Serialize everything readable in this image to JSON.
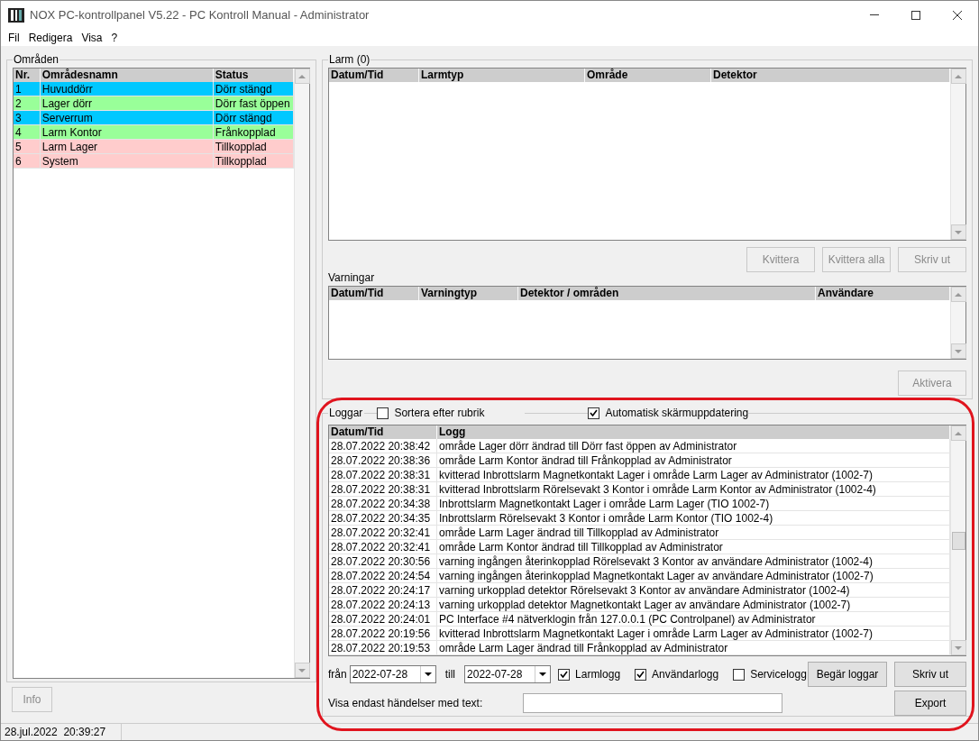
{
  "window": {
    "title": "NOX PC-kontrollpanel V5.22 - PC Kontroll Manual - Administrator"
  },
  "menu": [
    "Fil",
    "Redigera",
    "Visa",
    "?"
  ],
  "areas": {
    "title": "Områden",
    "columns": [
      "Nr.",
      "Områdesnamn",
      "Status"
    ],
    "rows": [
      {
        "nr": "1",
        "name": "Huvuddörr",
        "status": "Dörr stängd",
        "color": "#00c8ff"
      },
      {
        "nr": "2",
        "name": "Lager dörr",
        "status": "Dörr fast öppen",
        "color": "#99ff99"
      },
      {
        "nr": "3",
        "name": "Serverrum",
        "status": "Dörr stängd",
        "color": "#00c8ff"
      },
      {
        "nr": "4",
        "name": "Larm Kontor",
        "status": "Frånkopplad",
        "color": "#99ff99"
      },
      {
        "nr": "5",
        "name": "Larm Lager",
        "status": "Tillkopplad",
        "color": "#ffcccc"
      },
      {
        "nr": "6",
        "name": "System",
        "status": "Tillkopplad",
        "color": "#ffcccc"
      }
    ],
    "info_button": {
      "label": "Info",
      "disabled": true
    }
  },
  "alarms": {
    "title": "Larm (0)",
    "columns": [
      "Datum/Tid",
      "Larmtyp",
      "Område",
      "Detektor"
    ],
    "buttons": [
      {
        "label": "Kvittera",
        "disabled": true
      },
      {
        "label": "Kvittera alla",
        "disabled": true
      },
      {
        "label": "Skriv ut",
        "disabled": true
      }
    ]
  },
  "warnings": {
    "title": "Varningar",
    "columns": [
      "Datum/Tid",
      "Varningtyp",
      "Detektor / områden",
      "Användare"
    ],
    "button": {
      "label": "Aktivera",
      "disabled": true
    }
  },
  "logs": {
    "title": "Loggar",
    "options": [
      {
        "label": "Sortera efter rubrik",
        "checked": false
      },
      {
        "label": "Automatisk skärmuppdatering",
        "checked": true
      }
    ],
    "columns": [
      "Datum/Tid",
      "Logg"
    ],
    "rows": [
      [
        "28.07.2022 20:38:42",
        "område Lager dörr ändrad till Dörr fast öppen av Administrator"
      ],
      [
        "28.07.2022 20:38:36",
        "område Larm Kontor ändrad till Frånkopplad av Administrator"
      ],
      [
        "28.07.2022 20:38:31",
        "kvitterad Inbrottslarm Magnetkontakt Lager i område Larm Lager av Administrator (1002-7)"
      ],
      [
        "28.07.2022 20:38:31",
        "kvitterad Inbrottslarm Rörelsevakt 3 Kontor i område Larm Kontor av Administrator (1002-4)"
      ],
      [
        "28.07.2022 20:34:38",
        "Inbrottslarm Magnetkontakt Lager i område Larm Lager (TIO 1002-7)"
      ],
      [
        "28.07.2022 20:34:35",
        "Inbrottslarm Rörelsevakt 3 Kontor i område Larm Kontor (TIO 1002-4)"
      ],
      [
        "28.07.2022 20:32:41",
        "område Larm Lager ändrad till Tillkopplad av Administrator"
      ],
      [
        "28.07.2022 20:32:41",
        "område Larm Kontor ändrad till Tillkopplad av Administrator"
      ],
      [
        "28.07.2022 20:30:56",
        "varning ingången återinkopplad Rörelsevakt 3 Kontor av användare Administrator (1002-4)"
      ],
      [
        "28.07.2022 20:24:54",
        "varning ingången återinkopplad Magnetkontakt Lager av användare Administrator (1002-7)"
      ],
      [
        "28.07.2022 20:24:17",
        "varning urkopplad detektor Rörelsevakt 3 Kontor av användare Administrator (1002-4)"
      ],
      [
        "28.07.2022 20:24:13",
        "varning urkopplad detektor Magnetkontakt Lager av användare Administrator (1002-7)"
      ],
      [
        "28.07.2022 20:24:01",
        "PC Interface #4 nätverklogin från 127.0.0.1 (PC Controlpanel) av Administrator"
      ],
      [
        "28.07.2022 20:19:56",
        "kvitterad Inbrottslarm Magnetkontakt Lager i område Larm Lager av Administrator (1002-7)"
      ],
      [
        "28.07.2022 20:19:53",
        "område Larm Lager ändrad till Frånkopplad av Administrator"
      ]
    ],
    "from_label": "från",
    "from_date": "2022-07-28",
    "to_label": "till",
    "to_date": "2022-07-28",
    "log_types": [
      {
        "label": "Larmlogg",
        "checked": true
      },
      {
        "label": "Användarlogg",
        "checked": true
      },
      {
        "label": "Servicelogg",
        "checked": false
      }
    ],
    "buttons": [
      {
        "label": "Begär loggar",
        "disabled": false
      },
      {
        "label": "Skriv ut",
        "disabled": false
      },
      {
        "label": "Export",
        "disabled": false
      }
    ],
    "filter_label": "Visa endast händelser med text:"
  },
  "status_bar": {
    "datetime": "28.jul.2022  20:39:27"
  }
}
